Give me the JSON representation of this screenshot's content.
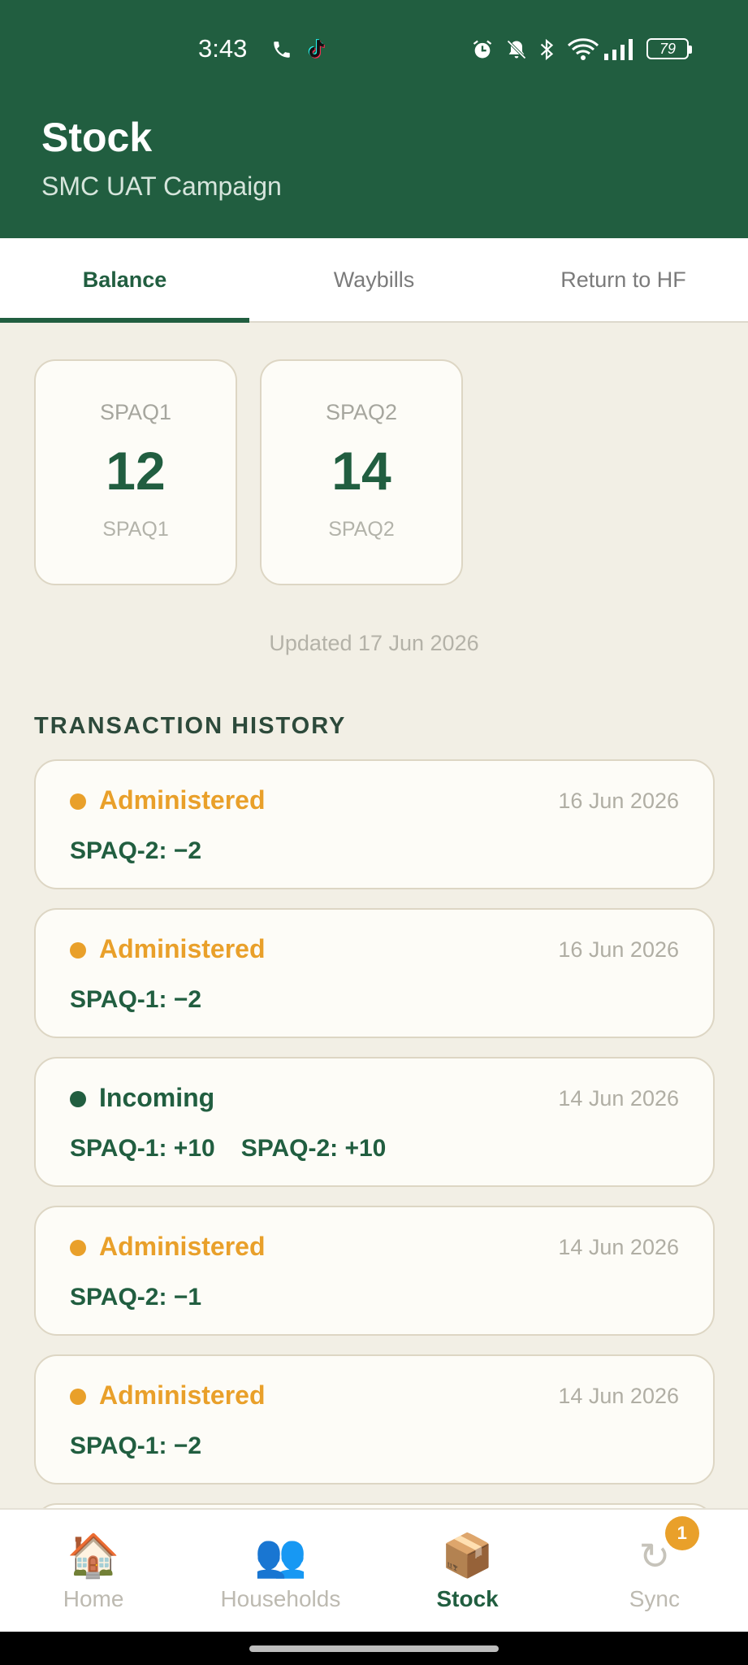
{
  "status_bar": {
    "time": "3:43",
    "battery": "79",
    "icons": [
      "phone-icon",
      "tiktok-icon",
      "alarm-icon",
      "bell-off-icon",
      "bluetooth-icon",
      "wifi-icon",
      "signal-icon",
      "battery-icon"
    ]
  },
  "header": {
    "title": "Stock",
    "subtitle": "SMC UAT Campaign"
  },
  "tabs": [
    {
      "label": "Balance",
      "active": true
    },
    {
      "label": "Waybills",
      "active": false
    },
    {
      "label": "Return to HF",
      "active": false
    }
  ],
  "balance": {
    "cards": [
      {
        "label_top": "SPAQ1",
        "quantity": "12",
        "label_bottom": "SPAQ1"
      },
      {
        "label_top": "SPAQ2",
        "quantity": "14",
        "label_bottom": "SPAQ2"
      }
    ],
    "updated": "Updated 17 Jun 2026"
  },
  "transactions": {
    "title": "TRANSACTION HISTORY",
    "items": [
      {
        "type": "Administered",
        "date": "16 Jun 2026",
        "lines": [
          "SPAQ-2: −2"
        ],
        "color": "#e9a02a"
      },
      {
        "type": "Administered",
        "date": "16 Jun 2026",
        "lines": [
          "SPAQ-1: −2"
        ],
        "color": "#e9a02a"
      },
      {
        "type": "Incoming",
        "date": "14 Jun 2026",
        "lines": [
          "SPAQ-1: +10",
          "SPAQ-2: +10"
        ],
        "color": "#215e40"
      },
      {
        "type": "Administered",
        "date": "14 Jun 2026",
        "lines": [
          "SPAQ-2: −1"
        ],
        "color": "#e9a02a"
      },
      {
        "type": "Administered",
        "date": "14 Jun 2026",
        "lines": [
          "SPAQ-1: −2"
        ],
        "color": "#e9a02a"
      }
    ]
  },
  "bottom_nav": {
    "items": [
      {
        "label": "Home",
        "icon": "house-icon"
      },
      {
        "label": "Households",
        "icon": "people-icon"
      },
      {
        "label": "Stock",
        "icon": "package-icon",
        "active": true
      },
      {
        "label": "Sync",
        "icon": "sync-icon",
        "badge": "1"
      }
    ]
  },
  "colors": {
    "primary": "#215e40",
    "accent": "#e9a02a",
    "background": "#f2efe5"
  }
}
